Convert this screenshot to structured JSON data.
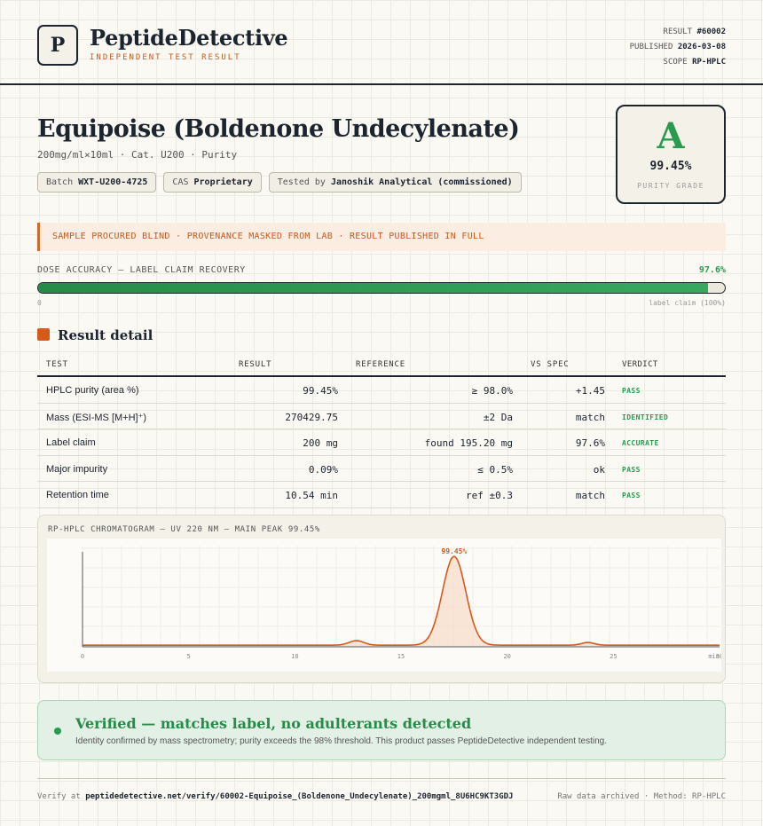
{
  "header": {
    "logo_letter": "P",
    "brand": "PeptideDetective",
    "brand_sub": "INDEPENDENT TEST RESULT",
    "result_label": "RESULT",
    "result_value": "#60002",
    "published_label": "PUBLISHED",
    "published_value": "2026-03-08",
    "scope_label": "SCOPE",
    "scope_value": "RP-HPLC"
  },
  "product": {
    "title": "Equipoise (Boldenone Undecylenate)",
    "subtitle": "200mg/ml×10ml · Cat. U200 · Purity",
    "chips": [
      {
        "label": "Batch",
        "value": "WXT-U200-4725"
      },
      {
        "label": "CAS",
        "value": "Proprietary"
      },
      {
        "label": "Tested by",
        "value": "Janoshik Analytical (commissioned)"
      }
    ]
  },
  "grade": {
    "letter": "A",
    "value": "99.45%",
    "label": "PURITY GRADE",
    "color": "#2a9a51"
  },
  "notice": "SAMPLE PROCURED BLIND · PROVENANCE MASKED FROM LAB · RESULT PUBLISHED IN FULL",
  "dose": {
    "label": "DOSE ACCURACY — LABEL CLAIM RECOVERY",
    "value": "97.6%",
    "fraction": 0.976,
    "min_label": "0",
    "max_label": "label claim (100%)"
  },
  "section_title": "Result detail",
  "table": {
    "headers": [
      "TEST",
      "RESULT",
      "REFERENCE",
      "VS SPEC",
      "VERDICT"
    ],
    "rows": [
      {
        "test": "HPLC purity (area %)",
        "result": "99.45%",
        "reference": "≥ 98.0%",
        "vs": "+1.45",
        "verdict": "PASS"
      },
      {
        "test": "Mass (ESI-MS [M+H]⁺)",
        "result": "270429.75",
        "reference": "±2 Da",
        "vs": "match",
        "verdict": "IDENTIFIED"
      },
      {
        "test": "Label claim",
        "result": "200 mg",
        "reference": "found 195.20 mg",
        "vs": "97.6%",
        "verdict": "ACCURATE"
      },
      {
        "test": "Major impurity",
        "result": "0.09%",
        "reference": "≤ 0.5%",
        "vs": "ok",
        "verdict": "PASS"
      },
      {
        "test": "Retention time",
        "result": "10.54 min",
        "reference": "ref ±0.3",
        "vs": "match",
        "verdict": "PASS"
      }
    ]
  },
  "chart_data": {
    "type": "line",
    "title": "RP-HPLC CHROMATOGRAM — UV 220 NM — MAIN PEAK 99.45%",
    "xlim": [
      0,
      30
    ],
    "x_ticks": [
      "0",
      "5",
      "10",
      "15",
      "20",
      "25",
      "30"
    ],
    "x_unit": "min",
    "peak_label": "99.45%",
    "peaks": [
      {
        "rt": 12.9,
        "height": 0.05
      },
      {
        "rt": 17.5,
        "height": 0.99
      },
      {
        "rt": 23.8,
        "height": 0.03
      }
    ],
    "color": "#d65a1c"
  },
  "verified": {
    "title": "Verified — matches label, no adulterants detected",
    "desc": "Identity confirmed by mass spectrometry; purity exceeds the 98% threshold. This product passes PeptideDetective independent testing."
  },
  "footer": {
    "verify_label": "Verify at",
    "verify_url": "peptidedetective.net/verify/60002-Equipoise_(Boldenone_Undecylenate)_200mgml_8U6HC9KT3GDJ",
    "right": "Raw data archived · Method: RP-HPLC"
  }
}
